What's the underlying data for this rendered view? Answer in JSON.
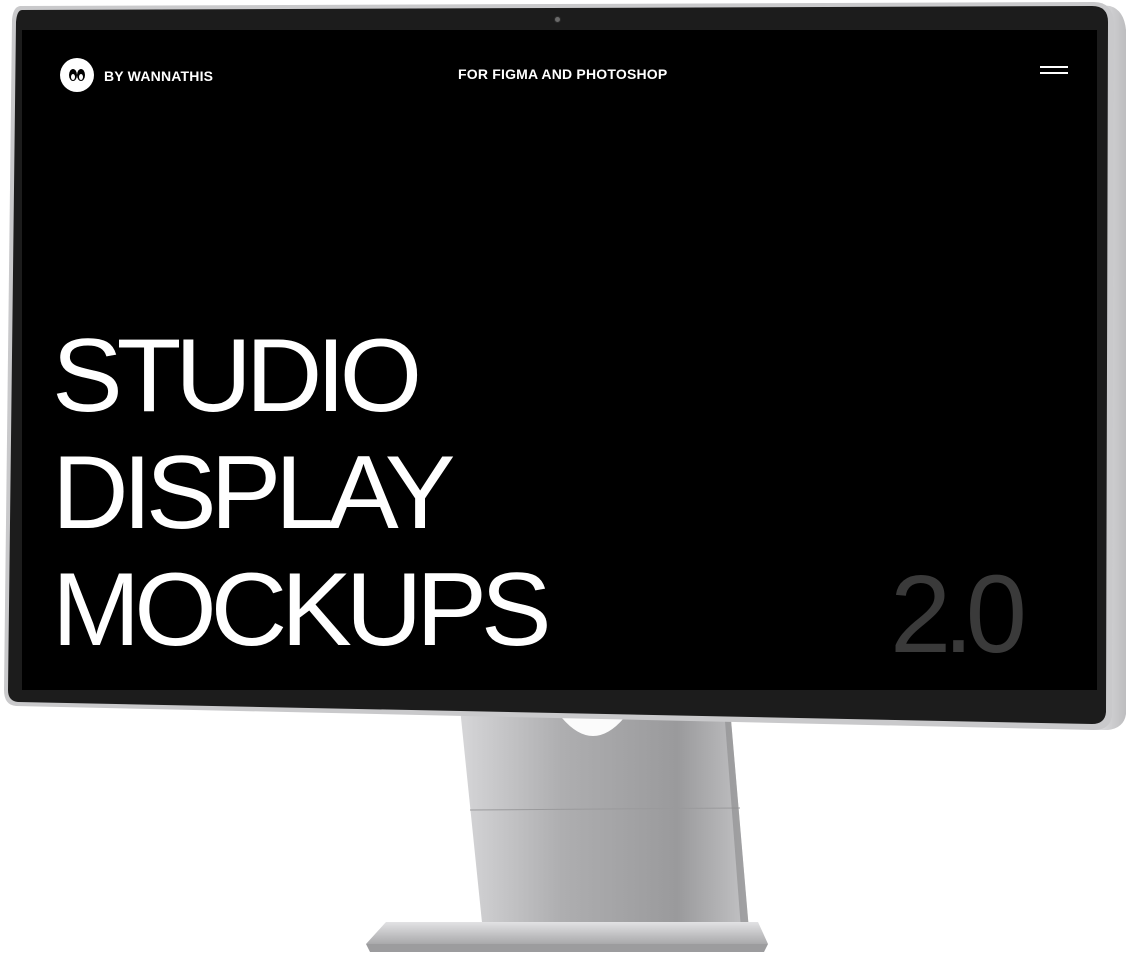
{
  "screen": {
    "brand": "BY WANNATHIS",
    "tagline": "FOR FIGMA AND PHOTOSHOP",
    "headline_lines": [
      "STUDIO",
      "DISPLAY",
      "MOCKUPS"
    ],
    "version": "2.0"
  },
  "colors": {
    "screen_bg": "#000000",
    "text": "#ffffff",
    "version_text": "#3a3a3a",
    "bezel": "#1c1c1c",
    "frame_silver": "#c9c9cb",
    "stand_silver": "#b8b8ba"
  },
  "icons": {
    "logo": "eyes-logo-icon",
    "menu": "hamburger-menu-icon",
    "camera": "camera-dot"
  }
}
